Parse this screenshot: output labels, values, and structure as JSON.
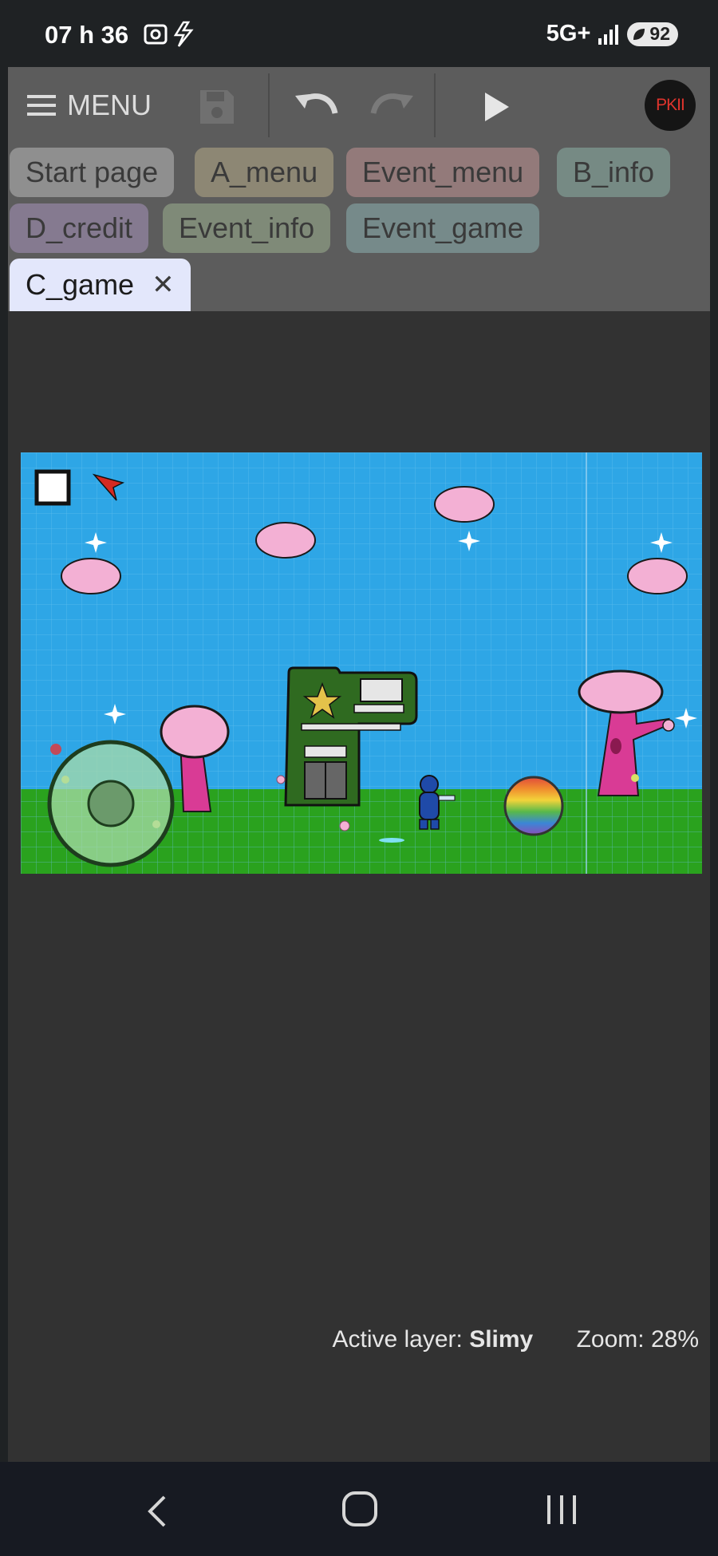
{
  "status_bar": {
    "time": "07 h 36",
    "network": "5G+",
    "battery": "92"
  },
  "toolbar": {
    "menu_label": "MENU",
    "logo_text": "PKII"
  },
  "tabs": [
    {
      "label": "Start page",
      "color": "#8f8f8f"
    },
    {
      "label": "A_menu",
      "color": "#8d8774"
    },
    {
      "label": "Event_menu",
      "color": "#937a7a"
    },
    {
      "label": "B_info",
      "color": "#768a84"
    },
    {
      "label": "D_credit",
      "color": "#857a90"
    },
    {
      "label": "Event_info",
      "color": "#7f8a78"
    },
    {
      "label": "Event_game",
      "color": "#768a8a"
    },
    {
      "label": "C_game",
      "color": "#e3e7fb",
      "active": true
    }
  ],
  "status": {
    "layer_label": "Active layer:",
    "layer_name": "Slimy",
    "zoom": "Zoom: 28%"
  },
  "colors": {
    "sky": "#2ea6e6",
    "grass": "#2aa21e",
    "cloud": "#f3b0d4",
    "tree_trunk": "#d93b95",
    "building": "#2f6a20"
  }
}
